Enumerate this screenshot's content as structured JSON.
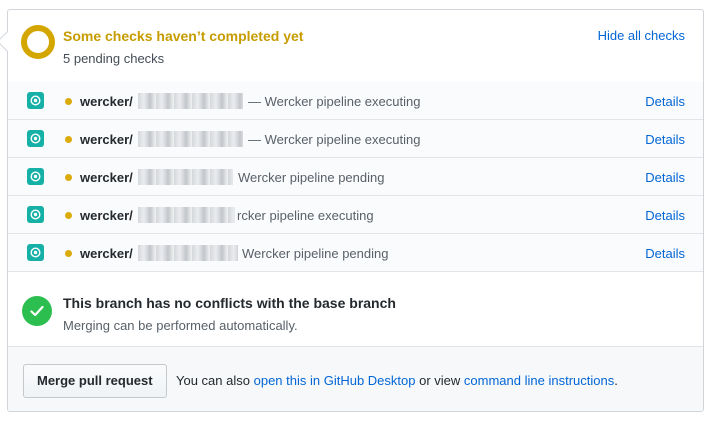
{
  "status_header": {
    "title": "Some checks haven’t completed yet",
    "subtitle": "5 pending checks",
    "hide_link": "Hide all checks",
    "status_color": "#dbab09"
  },
  "checks": [
    {
      "name": "wercker/",
      "description": "— Wercker pipeline executing",
      "details": "Details"
    },
    {
      "name": "wercker/",
      "description": "— Wercker pipeline executing",
      "details": "Details"
    },
    {
      "name": "wercker/",
      "description": "Wercker pipeline pending",
      "details": "Details"
    },
    {
      "name": "wercker/",
      "description": "rcker pipeline executing",
      "details": "Details"
    },
    {
      "name": "wercker/",
      "description": "Wercker pipeline pending",
      "details": "Details"
    }
  ],
  "merge_status": {
    "title": "This branch has no conflicts with the base branch",
    "subtitle": "Merging can be performed automatically.",
    "status_color": "#2cbe4e"
  },
  "merge_action": {
    "button_label": "Merge pull request",
    "text_prefix": "You can also",
    "desktop_link": "open this in GitHub Desktop",
    "text_middle": "or view",
    "cli_link": "command line instructions",
    "text_suffix": "."
  },
  "icons": {
    "pending": "pending-ring-icon",
    "app": "wercker-app-icon",
    "success": "check-circle-icon"
  }
}
